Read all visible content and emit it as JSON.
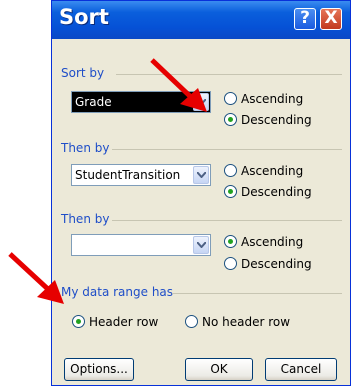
{
  "window": {
    "title": "Sort",
    "help_label": "?",
    "close_label": "X"
  },
  "sort_by": {
    "label": "Sort by",
    "value": "Grade",
    "ascending_label": "Ascending",
    "descending_label": "Descending",
    "selected": "descending"
  },
  "then_by_1": {
    "label": "Then by",
    "value": "StudentTransition",
    "ascending_label": "Ascending",
    "descending_label": "Descending",
    "selected": "descending"
  },
  "then_by_2": {
    "label": "Then by",
    "value": "",
    "ascending_label": "Ascending",
    "descending_label": "Descending",
    "selected": "ascending"
  },
  "header": {
    "label": "My data range has",
    "header_row_label": "Header row",
    "no_header_row_label": "No header row",
    "selected": "header_row"
  },
  "buttons": {
    "options_label": "Options...",
    "ok_label": "OK",
    "cancel_label": "Cancel"
  },
  "colors": {
    "arrow": "#e60000",
    "title_bar": "#0a5fdc",
    "accent": "#1f4ec8",
    "radio_dot": "#21a121"
  }
}
